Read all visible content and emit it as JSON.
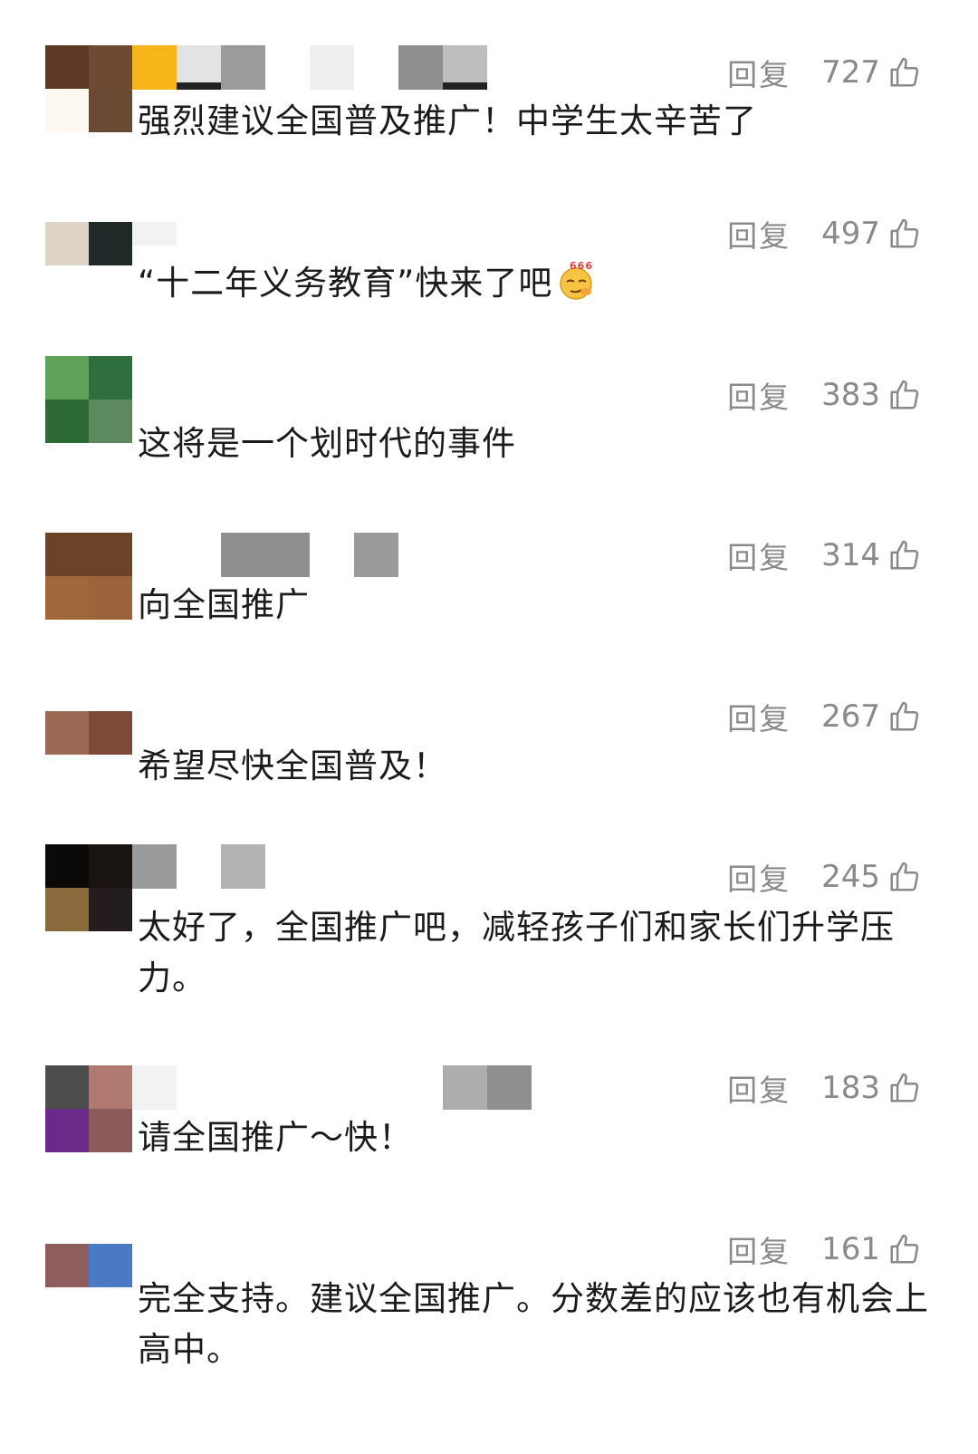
{
  "comments": [
    {
      "reply_label": "回复",
      "likes": "727",
      "text": "强烈建议全国普及推广！中学生太辛苦了"
    },
    {
      "reply_label": "回复",
      "likes": "497",
      "text": "“十二年义务教育”快来了吧",
      "emoji_text": "666"
    },
    {
      "reply_label": "回复",
      "likes": "383",
      "text": "这将是一个划时代的事件"
    },
    {
      "reply_label": "回复",
      "likes": "314",
      "text": "向全国推广"
    },
    {
      "reply_label": "回复",
      "likes": "267",
      "text": "希望尽快全国普及！"
    },
    {
      "reply_label": "回复",
      "likes": "245",
      "text": "太好了，全国推广吧，减轻孩子们和家长们升学压力。"
    },
    {
      "reply_label": "回复",
      "likes": "183",
      "text": "请全国推广～快！"
    },
    {
      "reply_label": "回复",
      "likes": "161",
      "text": "完全支持。建议全国推广。分数差的应该也有机会上高中。"
    }
  ],
  "colors": {
    "text": "#1b1b1b",
    "meta": "#8a8a8a",
    "emoji_yellow": "#f6c343",
    "emoji_red": "#e2403a"
  },
  "icons": {
    "like": "thumbs-up-icon",
    "emoji": "666-emoji-icon"
  }
}
